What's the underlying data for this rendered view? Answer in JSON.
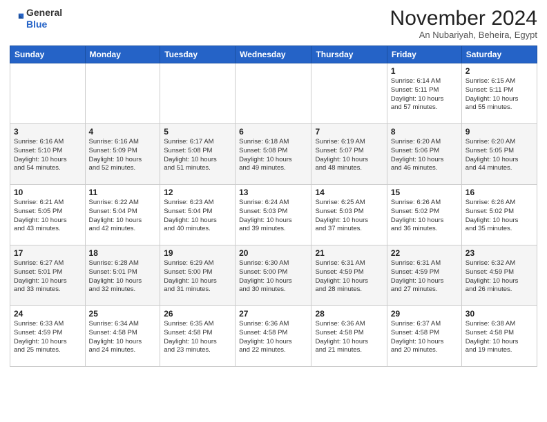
{
  "header": {
    "logo_line1": "General",
    "logo_line2": "Blue",
    "month": "November 2024",
    "location": "An Nubariyah, Beheira, Egypt"
  },
  "weekdays": [
    "Sunday",
    "Monday",
    "Tuesday",
    "Wednesday",
    "Thursday",
    "Friday",
    "Saturday"
  ],
  "weeks": [
    [
      {
        "day": "",
        "info": ""
      },
      {
        "day": "",
        "info": ""
      },
      {
        "day": "",
        "info": ""
      },
      {
        "day": "",
        "info": ""
      },
      {
        "day": "",
        "info": ""
      },
      {
        "day": "1",
        "info": "Sunrise: 6:14 AM\nSunset: 5:11 PM\nDaylight: 10 hours\nand 57 minutes."
      },
      {
        "day": "2",
        "info": "Sunrise: 6:15 AM\nSunset: 5:11 PM\nDaylight: 10 hours\nand 55 minutes."
      }
    ],
    [
      {
        "day": "3",
        "info": "Sunrise: 6:16 AM\nSunset: 5:10 PM\nDaylight: 10 hours\nand 54 minutes."
      },
      {
        "day": "4",
        "info": "Sunrise: 6:16 AM\nSunset: 5:09 PM\nDaylight: 10 hours\nand 52 minutes."
      },
      {
        "day": "5",
        "info": "Sunrise: 6:17 AM\nSunset: 5:08 PM\nDaylight: 10 hours\nand 51 minutes."
      },
      {
        "day": "6",
        "info": "Sunrise: 6:18 AM\nSunset: 5:08 PM\nDaylight: 10 hours\nand 49 minutes."
      },
      {
        "day": "7",
        "info": "Sunrise: 6:19 AM\nSunset: 5:07 PM\nDaylight: 10 hours\nand 48 minutes."
      },
      {
        "day": "8",
        "info": "Sunrise: 6:20 AM\nSunset: 5:06 PM\nDaylight: 10 hours\nand 46 minutes."
      },
      {
        "day": "9",
        "info": "Sunrise: 6:20 AM\nSunset: 5:05 PM\nDaylight: 10 hours\nand 44 minutes."
      }
    ],
    [
      {
        "day": "10",
        "info": "Sunrise: 6:21 AM\nSunset: 5:05 PM\nDaylight: 10 hours\nand 43 minutes."
      },
      {
        "day": "11",
        "info": "Sunrise: 6:22 AM\nSunset: 5:04 PM\nDaylight: 10 hours\nand 42 minutes."
      },
      {
        "day": "12",
        "info": "Sunrise: 6:23 AM\nSunset: 5:04 PM\nDaylight: 10 hours\nand 40 minutes."
      },
      {
        "day": "13",
        "info": "Sunrise: 6:24 AM\nSunset: 5:03 PM\nDaylight: 10 hours\nand 39 minutes."
      },
      {
        "day": "14",
        "info": "Sunrise: 6:25 AM\nSunset: 5:03 PM\nDaylight: 10 hours\nand 37 minutes."
      },
      {
        "day": "15",
        "info": "Sunrise: 6:26 AM\nSunset: 5:02 PM\nDaylight: 10 hours\nand 36 minutes."
      },
      {
        "day": "16",
        "info": "Sunrise: 6:26 AM\nSunset: 5:02 PM\nDaylight: 10 hours\nand 35 minutes."
      }
    ],
    [
      {
        "day": "17",
        "info": "Sunrise: 6:27 AM\nSunset: 5:01 PM\nDaylight: 10 hours\nand 33 minutes."
      },
      {
        "day": "18",
        "info": "Sunrise: 6:28 AM\nSunset: 5:01 PM\nDaylight: 10 hours\nand 32 minutes."
      },
      {
        "day": "19",
        "info": "Sunrise: 6:29 AM\nSunset: 5:00 PM\nDaylight: 10 hours\nand 31 minutes."
      },
      {
        "day": "20",
        "info": "Sunrise: 6:30 AM\nSunset: 5:00 PM\nDaylight: 10 hours\nand 30 minutes."
      },
      {
        "day": "21",
        "info": "Sunrise: 6:31 AM\nSunset: 4:59 PM\nDaylight: 10 hours\nand 28 minutes."
      },
      {
        "day": "22",
        "info": "Sunrise: 6:31 AM\nSunset: 4:59 PM\nDaylight: 10 hours\nand 27 minutes."
      },
      {
        "day": "23",
        "info": "Sunrise: 6:32 AM\nSunset: 4:59 PM\nDaylight: 10 hours\nand 26 minutes."
      }
    ],
    [
      {
        "day": "24",
        "info": "Sunrise: 6:33 AM\nSunset: 4:59 PM\nDaylight: 10 hours\nand 25 minutes."
      },
      {
        "day": "25",
        "info": "Sunrise: 6:34 AM\nSunset: 4:58 PM\nDaylight: 10 hours\nand 24 minutes."
      },
      {
        "day": "26",
        "info": "Sunrise: 6:35 AM\nSunset: 4:58 PM\nDaylight: 10 hours\nand 23 minutes."
      },
      {
        "day": "27",
        "info": "Sunrise: 6:36 AM\nSunset: 4:58 PM\nDaylight: 10 hours\nand 22 minutes."
      },
      {
        "day": "28",
        "info": "Sunrise: 6:36 AM\nSunset: 4:58 PM\nDaylight: 10 hours\nand 21 minutes."
      },
      {
        "day": "29",
        "info": "Sunrise: 6:37 AM\nSunset: 4:58 PM\nDaylight: 10 hours\nand 20 minutes."
      },
      {
        "day": "30",
        "info": "Sunrise: 6:38 AM\nSunset: 4:58 PM\nDaylight: 10 hours\nand 19 minutes."
      }
    ]
  ]
}
